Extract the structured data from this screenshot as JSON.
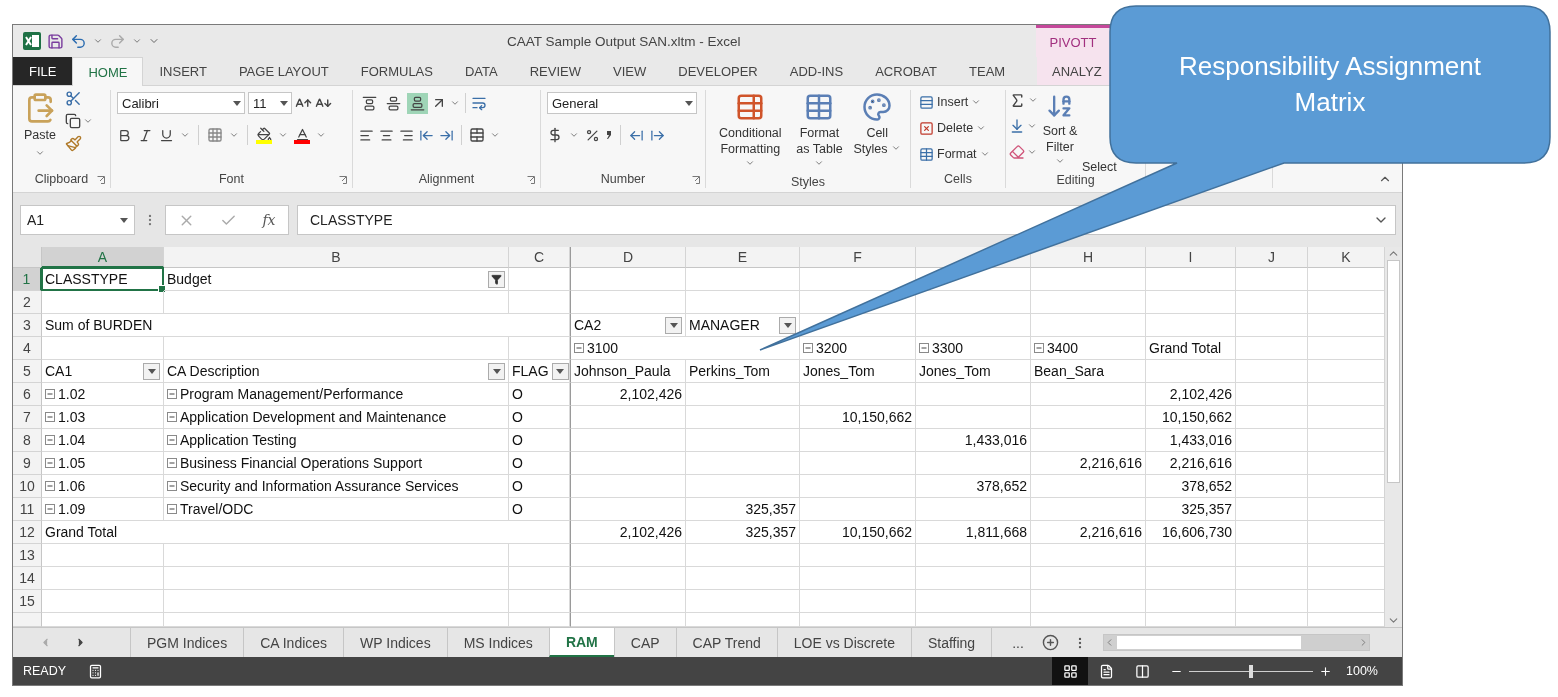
{
  "window": {
    "title": "CAAT Sample Output SAN.xltm - Excel",
    "context_header": "PIVOTT"
  },
  "tabs": [
    {
      "label": "FILE",
      "kind": "file",
      "selected": false
    },
    {
      "label": "HOME",
      "kind": "normal",
      "selected": true
    },
    {
      "label": "INSERT",
      "kind": "normal",
      "selected": false
    },
    {
      "label": "PAGE LAYOUT",
      "kind": "normal",
      "selected": false
    },
    {
      "label": "FORMULAS",
      "kind": "normal",
      "selected": false
    },
    {
      "label": "DATA",
      "kind": "normal",
      "selected": false
    },
    {
      "label": "REVIEW",
      "kind": "normal",
      "selected": false
    },
    {
      "label": "VIEW",
      "kind": "normal",
      "selected": false
    },
    {
      "label": "DEVELOPER",
      "kind": "normal",
      "selected": false
    },
    {
      "label": "ADD-INS",
      "kind": "normal",
      "selected": false
    },
    {
      "label": "ACROBAT",
      "kind": "normal",
      "selected": false
    },
    {
      "label": "TEAM",
      "kind": "normal",
      "selected": false
    },
    {
      "label": "ANALYZ",
      "kind": "contextual",
      "selected": false
    }
  ],
  "ribbon": {
    "groups": [
      {
        "kind": "clipboard",
        "label": "Clipboard",
        "paste": "Paste"
      },
      {
        "kind": "font",
        "label": "Font",
        "font_name": "Calibri",
        "font_size": "11"
      },
      {
        "kind": "alignment",
        "label": "Alignment",
        "vertical": [
          {
            "kind": "top",
            "on": false
          },
          {
            "kind": "middle",
            "on": false
          },
          {
            "kind": "bottom",
            "on": true
          }
        ]
      },
      {
        "kind": "number",
        "label": "Number",
        "format": "General"
      },
      {
        "kind": "styles",
        "label": "Styles",
        "buttons": [
          {
            "kind": "conditional",
            "label": "Conditional Formatting"
          },
          {
            "kind": "table",
            "label": "Format as Table"
          },
          {
            "kind": "cell_styles",
            "label": "Cell Styles"
          }
        ]
      },
      {
        "kind": "cells",
        "label": "Cells",
        "buttons": [
          {
            "kind": "insert",
            "label": "Insert"
          },
          {
            "kind": "delete",
            "label": "Delete"
          },
          {
            "kind": "format",
            "label": "Format"
          }
        ]
      },
      {
        "kind": "editing",
        "label": "Editing",
        "sort_filter": "Sort & Filter",
        "select": "Select"
      }
    ]
  },
  "formula_bar": {
    "name_box": "A1",
    "function_label": "fx",
    "formula": "CLASSTYPE"
  },
  "sheet": {
    "columns": [
      {
        "letter": "A",
        "selected": true
      },
      {
        "letter": "B",
        "selected": false
      },
      {
        "letter": "C",
        "selected": false
      },
      {
        "letter": "D",
        "selected": false
      },
      {
        "letter": "E",
        "selected": false
      },
      {
        "letter": "F",
        "selected": false
      },
      {
        "selected": false
      },
      {
        "letter": "H",
        "selected": false
      },
      {
        "letter": "I",
        "selected": false
      },
      {
        "letter": "J",
        "selected": false
      },
      {
        "letter": "K",
        "selected": false
      }
    ],
    "rows": [
      {
        "number": "1",
        "selected": true,
        "cells": [
          {
            "text": "CLASSTYPE",
            "kind": "text",
            "selected": true
          },
          {
            "text": "Budget",
            "kind": "filter",
            "selected": false
          }
        ]
      },
      {
        "number": "2",
        "selected": false
      },
      {
        "number": "3",
        "selected": false,
        "cells": [
          {
            "text": "Sum of BURDEN",
            "kind": "span",
            "selected": false
          },
          {},
          {},
          {
            "text": "CA2",
            "kind": "dropdown",
            "selected": false
          },
          {
            "text": "MANAGER",
            "kind": "dropdown",
            "selected": false
          }
        ]
      },
      {
        "number": "4",
        "selected": false,
        "cells": [
          {},
          {},
          {},
          {
            "text": "3100",
            "kind": "group",
            "selected": false
          },
          {},
          {
            "text": "3200",
            "kind": "group",
            "selected": false
          },
          {
            "text": "3300",
            "kind": "group",
            "selected": false
          },
          {
            "text": "3400",
            "kind": "group",
            "selected": false
          },
          {
            "text": "Grand Total",
            "kind": "text",
            "selected": false
          }
        ]
      },
      {
        "number": "5",
        "selected": false,
        "cells": [
          {
            "text": "CA1",
            "kind": "dropdown",
            "selected": false
          },
          {
            "text": "CA Description",
            "kind": "dropdown",
            "selected": false
          },
          {
            "text": "FLAG",
            "kind": "dropdown",
            "selected": false
          },
          {
            "text": "Johnson_Paula",
            "kind": "text",
            "selected": false
          },
          {
            "text": "Perkins_Tom",
            "kind": "text",
            "selected": false
          },
          {
            "text": "Jones_Tom",
            "kind": "text",
            "selected": false
          },
          {
            "text": "Jones_Tom",
            "kind": "text",
            "selected": false
          },
          {
            "text": "Bean_Sara",
            "kind": "text",
            "selected": false
          }
        ]
      },
      {
        "number": "6",
        "selected": false,
        "cells": [
          {
            "text": "1.02",
            "kind": "group",
            "selected": false
          },
          {
            "text": "Program Management/Performance",
            "kind": "group",
            "selected": false
          },
          {
            "text": "O",
            "kind": "text",
            "selected": false
          },
          {
            "text": "2,102,426",
            "kind": "number",
            "selected": false
          },
          {},
          {},
          {},
          {},
          {
            "text": "2,102,426",
            "kind": "number",
            "selected": false
          }
        ]
      },
      {
        "number": "7",
        "selected": false,
        "cells": [
          {
            "text": "1.03",
            "kind": "group",
            "selected": false
          },
          {
            "text": "Application Development and Maintenance",
            "kind": "group",
            "selected": false
          },
          {
            "text": "O",
            "kind": "text",
            "selected": false
          },
          {},
          {},
          {
            "text": "10,150,662",
            "kind": "number",
            "selected": false
          },
          {},
          {},
          {
            "text": "10,150,662",
            "kind": "number",
            "selected": false
          }
        ]
      },
      {
        "number": "8",
        "selected": false,
        "cells": [
          {
            "text": "1.04",
            "kind": "group",
            "selected": false
          },
          {
            "text": "Application Testing",
            "kind": "group",
            "selected": false
          },
          {
            "text": "O",
            "kind": "text",
            "selected": false
          },
          {},
          {},
          {},
          {
            "text": "1,433,016",
            "kind": "number",
            "selected": false
          },
          {},
          {
            "text": "1,433,016",
            "kind": "number",
            "selected": false
          }
        ]
      },
      {
        "number": "9",
        "selected": false,
        "cells": [
          {
            "text": "1.05",
            "kind": "group",
            "selected": false
          },
          {
            "text": "Business Financial Operations Support",
            "kind": "group",
            "selected": false
          },
          {
            "text": "O",
            "kind": "text",
            "selected": false
          },
          {},
          {},
          {},
          {},
          {
            "text": "2,216,616",
            "kind": "number",
            "selected": false
          },
          {
            "text": "2,216,616",
            "kind": "number",
            "selected": false
          }
        ]
      },
      {
        "number": "10",
        "selected": false,
        "cells": [
          {
            "text": "1.06",
            "kind": "group",
            "selected": false
          },
          {
            "text": "Security and Information Assurance Services",
            "kind": "group",
            "selected": false
          },
          {
            "text": "O",
            "kind": "text",
            "selected": false
          },
          {},
          {},
          {},
          {
            "text": "378,652",
            "kind": "number",
            "selected": false
          },
          {},
          {
            "text": "378,652",
            "kind": "number",
            "selected": false
          }
        ]
      },
      {
        "number": "11",
        "selected": false,
        "cells": [
          {
            "text": "1.09",
            "kind": "group",
            "selected": false
          },
          {
            "text": "Travel/ODC",
            "kind": "group",
            "selected": false
          },
          {
            "text": "O",
            "kind": "text",
            "selected": false
          },
          {},
          {
            "text": "325,357",
            "kind": "number",
            "selected": false
          },
          {},
          {},
          {},
          {
            "text": "325,357",
            "kind": "number",
            "selected": false
          }
        ]
      },
      {
        "number": "12",
        "selected": false,
        "cells": [
          {
            "text": "Grand Total",
            "kind": "span",
            "selected": false
          },
          {},
          {},
          {
            "text": "2,102,426",
            "kind": "number",
            "selected": false
          },
          {
            "text": "325,357",
            "kind": "number",
            "selected": false
          },
          {
            "text": "10,150,662",
            "kind": "number",
            "selected": false
          },
          {
            "text": "1,811,668",
            "kind": "number",
            "selected": false
          },
          {
            "text": "2,216,616",
            "kind": "number",
            "selected": false
          },
          {
            "text": "16,606,730",
            "kind": "number",
            "selected": false
          }
        ]
      },
      {
        "number": "13",
        "selected": false
      },
      {
        "number": "14",
        "selected": false
      },
      {
        "number": "15",
        "selected": false
      }
    ]
  },
  "sheet_tabs": [
    {
      "label": "PGM Indices",
      "selected": false
    },
    {
      "label": "CA Indices",
      "selected": false
    },
    {
      "label": "WP Indices",
      "selected": false
    },
    {
      "label": "MS Indices",
      "selected": false
    },
    {
      "label": "RAM",
      "selected": true
    },
    {
      "label": "CAP",
      "selected": false
    },
    {
      "label": "CAP Trend",
      "selected": false
    },
    {
      "label": "LOE vs Discrete",
      "selected": false
    },
    {
      "label": "Staffing",
      "selected": false
    }
  ],
  "more_tabs": "...",
  "status_bar": {
    "mode": "READY",
    "views": [
      {
        "kind": "normal",
        "selected": true
      },
      {
        "kind": "page_layout",
        "selected": false
      },
      {
        "kind": "page_break",
        "selected": false
      }
    ],
    "zoom_slider": {
      "level": 0.5
    },
    "zoom": "100%"
  },
  "callout": {
    "text": "Responsibility Assignment Matrix"
  }
}
